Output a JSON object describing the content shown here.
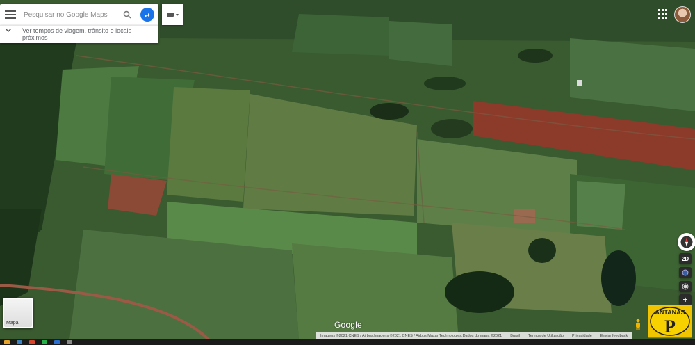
{
  "search": {
    "placeholder": "Pesquisar no Google Maps",
    "menu_icon": "hamburger-menu-icon",
    "search_icon": "search-icon",
    "directions_icon": "directions-icon",
    "directions_color": "#1a73e8"
  },
  "travel": {
    "text": "Ver tempos de viagem, trânsito e locais próximos",
    "icon": "chevron-down-icon"
  },
  "input_tools": {
    "icon": "keyboard-icon"
  },
  "header_right": {
    "apps_icon": "apps-grid-icon",
    "avatar": "user-avatar"
  },
  "controls": {
    "view_2d": "2D",
    "zoom_in": "+"
  },
  "minimap": {
    "label": "Mapa"
  },
  "brand": {
    "wordmark": "Google"
  },
  "footer": {
    "attribution": "Imagens ©2021 CNES / Airbus,Imagens ©2021 CNES / Airbus,Maxar Technologies,Dados do mapa ©2021",
    "country": "Brasil",
    "terms": "Termos de Utilização",
    "privacy": "Privacidade",
    "feedback": "Enviar feedback"
  },
  "overlay_logo": {
    "text": "ANTANAS",
    "letter": "P"
  },
  "colors": {
    "field_dark": "#2d4a26",
    "field_red": "#8c3b2a",
    "road": "#9a5a45"
  }
}
